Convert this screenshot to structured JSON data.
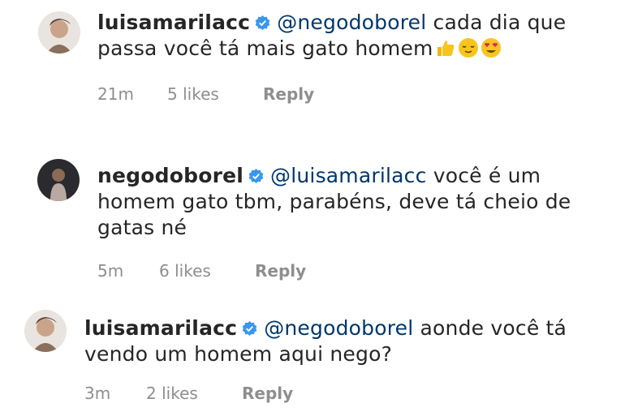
{
  "comments": [
    {
      "username": "luisamarilacc",
      "mention": "@negodoborel",
      "text": "cada dia que passa você tá mais gato homem",
      "emojis": [
        "thumbs-up",
        "relieved-face",
        "heart-eyes-face"
      ],
      "time": "21m",
      "likes": "5 likes",
      "reply": "Reply"
    },
    {
      "username": "negodoborel",
      "mention": "@luisamarilacc",
      "text": "você é um homem gato tbm, parabéns, deve tá cheio de gatas né",
      "time": "5m",
      "likes": "6 likes",
      "reply": "Reply"
    },
    {
      "username": "luisamarilacc",
      "mention": "@negodoborel",
      "text": "aonde você tá vendo um homem aqui nego?",
      "time": "3m",
      "likes": "2 likes",
      "reply": "Reply"
    }
  ],
  "colors": {
    "verified": "#3897f0",
    "mention": "#00376b",
    "meta": "#8e8e8e"
  }
}
